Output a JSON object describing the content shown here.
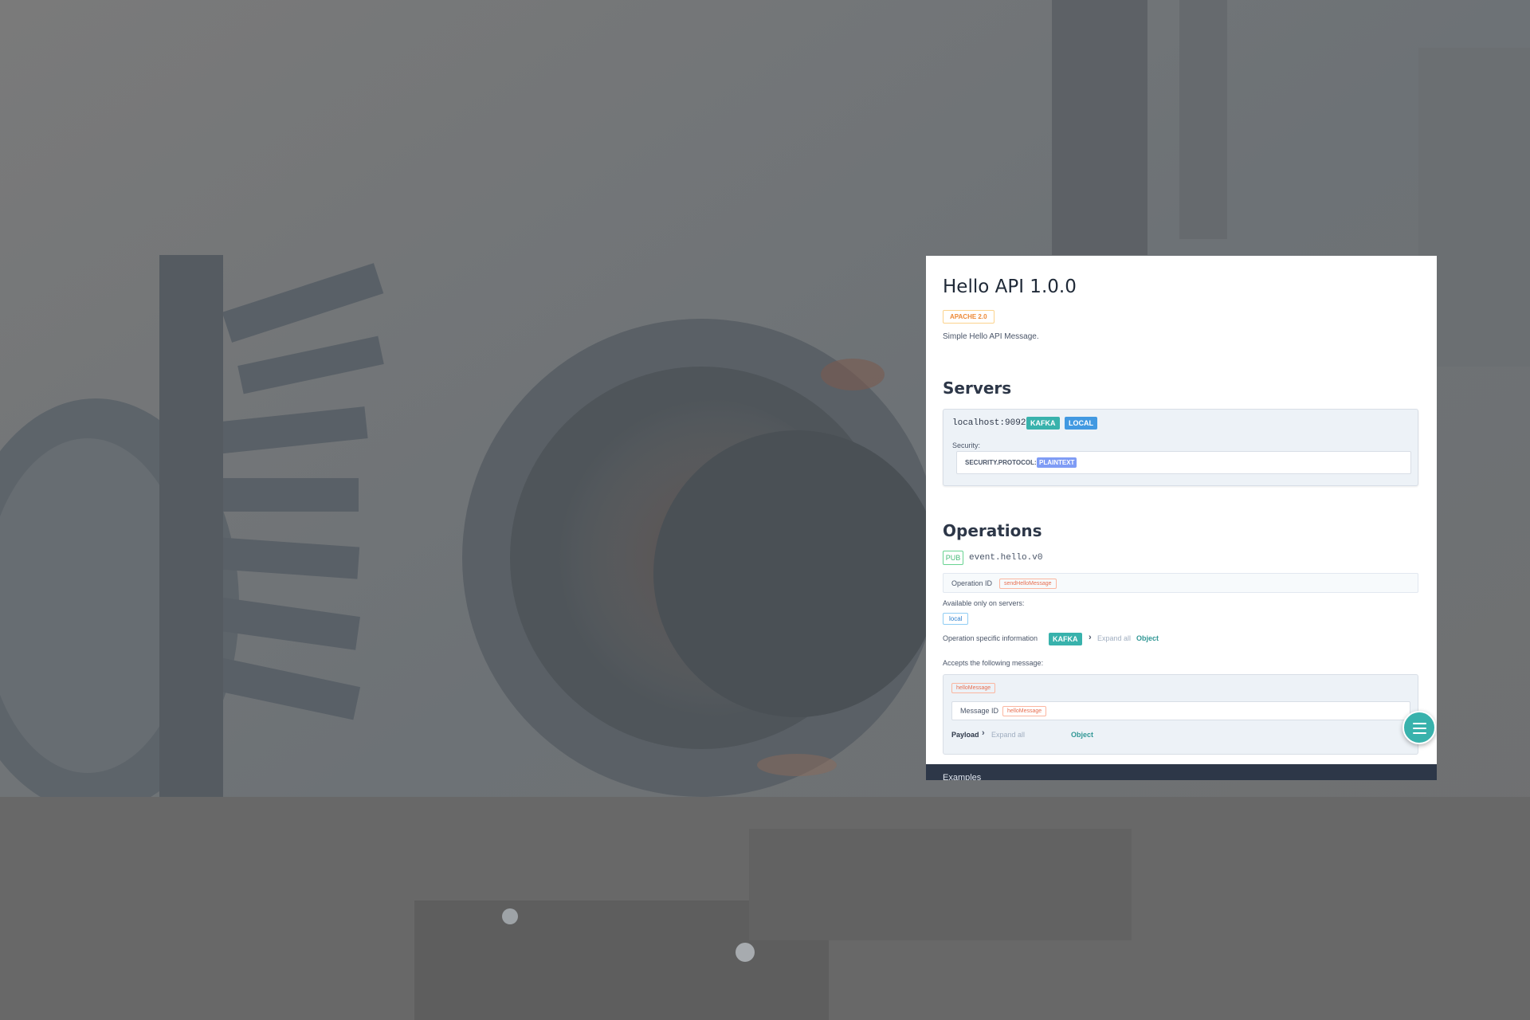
{
  "doc": {
    "title": "Hello API 1.0.0",
    "license": "APACHE 2.0",
    "description": "Simple Hello API Message."
  },
  "servers": {
    "heading": "Servers",
    "url": "localhost:9092",
    "protocol_badge": "KAFKA",
    "name_badge": "LOCAL",
    "security_label": "Security:",
    "security_key": "SECURITY.PROTOCOL:",
    "security_value": "PLAINTEXT"
  },
  "operations": {
    "heading": "Operations",
    "type_badge": "PUB",
    "channel": "event.hello.v0",
    "operation_id_label": "Operation ID",
    "operation_id": "sendHelloMessage",
    "available_label": "Available only on servers:",
    "server_tag": "local",
    "specific_info_label": "Operation specific information",
    "specific_info_badge": "KAFKA",
    "expand_all": "Expand all",
    "object_label": "Object",
    "accepts_label": "Accepts the following message:",
    "message_tag": "helloMessage",
    "message_id_label": "Message ID",
    "message_id": "helloMessage",
    "payload_label": "Payload",
    "payload_expand_all": "Expand all",
    "payload_object": "Object"
  },
  "examples": {
    "label": "Examples"
  },
  "icons": {
    "fab": "hamburger-menu-icon",
    "chevron": "chevron-right-icon"
  },
  "colors": {
    "accent_teal": "#38b2ac",
    "accent_blue": "#4299e1",
    "license_orange": "#ed8936"
  }
}
